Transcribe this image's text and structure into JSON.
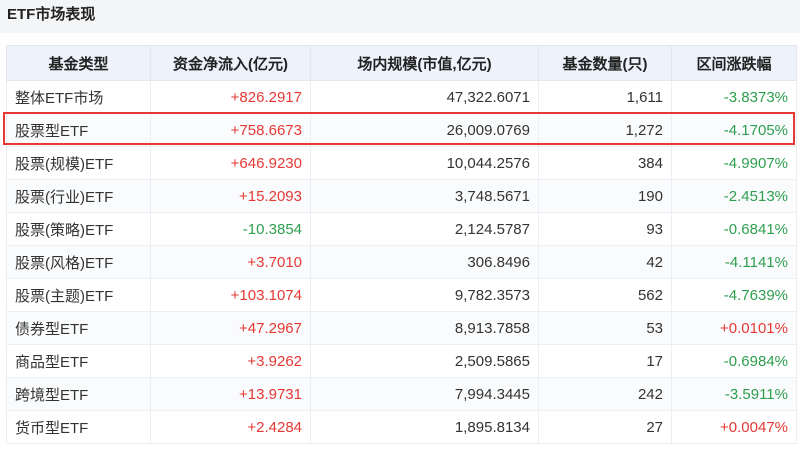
{
  "title": "ETF市场表现",
  "columns": [
    "基金类型",
    "资金净流入(亿元)",
    "场内规模(市值,亿元)",
    "基金数量(只)",
    "区间涨跌幅"
  ],
  "rows": [
    {
      "type": "整体ETF市场",
      "net_inflow": "+826.2917",
      "scale": "47,322.6071",
      "count": "1,611",
      "change": "-3.8373%"
    },
    {
      "type": "股票型ETF",
      "net_inflow": "+758.6673",
      "scale": "26,009.0769",
      "count": "1,272",
      "change": "-4.1705%"
    },
    {
      "type": "股票(规模)ETF",
      "net_inflow": "+646.9230",
      "scale": "10,044.2576",
      "count": "384",
      "change": "-4.9907%"
    },
    {
      "type": "股票(行业)ETF",
      "net_inflow": "+15.2093",
      "scale": "3,748.5671",
      "count": "190",
      "change": "-2.4513%"
    },
    {
      "type": "股票(策略)ETF",
      "net_inflow": "-10.3854",
      "scale": "2,124.5787",
      "count": "93",
      "change": "-0.6841%"
    },
    {
      "type": "股票(风格)ETF",
      "net_inflow": "+3.7010",
      "scale": "306.8496",
      "count": "42",
      "change": "-4.1141%"
    },
    {
      "type": "股票(主题)ETF",
      "net_inflow": "+103.1074",
      "scale": "9,782.3573",
      "count": "562",
      "change": "-4.7639%"
    },
    {
      "type": "债券型ETF",
      "net_inflow": "+47.2967",
      "scale": "8,913.7858",
      "count": "53",
      "change": "+0.0101%"
    },
    {
      "type": "商品型ETF",
      "net_inflow": "+3.9262",
      "scale": "2,509.5865",
      "count": "17",
      "change": "-0.6984%"
    },
    {
      "type": "跨境型ETF",
      "net_inflow": "+13.9731",
      "scale": "7,994.3445",
      "count": "242",
      "change": "-3.5911%"
    },
    {
      "type": "货币型ETF",
      "net_inflow": "+2.4284",
      "scale": "1,895.8134",
      "count": "27",
      "change": "+0.0047%"
    }
  ],
  "highlighted_row": 1,
  "colors": {
    "positive": "#e53935",
    "negative": "#2e9e4f",
    "highlight": "#e53935",
    "header_bg": "#eef3fb"
  }
}
